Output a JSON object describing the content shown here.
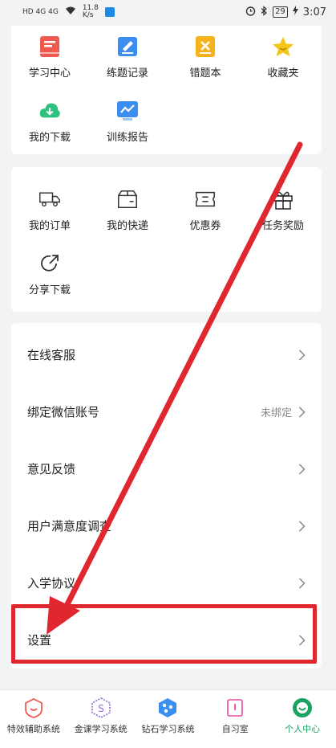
{
  "status_bar": {
    "network": "HD 4G 4G",
    "speed": "11.8\nK/s",
    "battery": "29",
    "time": "3:07"
  },
  "learn_grid": [
    {
      "label": "学习中心",
      "icon": "book-icon",
      "color": "#ef5a50"
    },
    {
      "label": "练题记录",
      "icon": "pencil-note-icon",
      "color": "#3b8ef0"
    },
    {
      "label": "错题本",
      "icon": "wrong-note-icon",
      "color": "#f5b21a"
    },
    {
      "label": "收藏夹",
      "icon": "star-icon",
      "color": "#f5c518"
    },
    {
      "label": "我的下载",
      "icon": "cloud-download-icon",
      "color": "#2ec27e"
    },
    {
      "label": "训练报告",
      "icon": "report-chart-icon",
      "color": "#3b8ef0"
    }
  ],
  "order_grid": [
    {
      "label": "我的订单",
      "icon": "truck-icon"
    },
    {
      "label": "我的快递",
      "icon": "package-icon"
    },
    {
      "label": "优惠券",
      "icon": "coupon-icon"
    },
    {
      "label": "任务奖励",
      "icon": "gift-icon"
    },
    {
      "label": "分享下载",
      "icon": "share-icon"
    }
  ],
  "menu": [
    {
      "title": "在线客服",
      "value": ""
    },
    {
      "title": "绑定微信账号",
      "value": "未绑定"
    },
    {
      "title": "意见反馈",
      "value": ""
    },
    {
      "title": "用户满意度调查",
      "value": ""
    },
    {
      "title": "入学协议",
      "value": ""
    },
    {
      "title": "设置",
      "value": ""
    }
  ],
  "tabs": [
    {
      "label": "特效辅助系统",
      "icon": "heart-shield-icon",
      "color": "#ef5a50"
    },
    {
      "label": "金课学习系统",
      "icon": "s-hexagon-icon",
      "color": "#8e6ad8"
    },
    {
      "label": "钻石学习系统",
      "icon": "molecule-icon",
      "color": "#3b8ef0"
    },
    {
      "label": "自习室",
      "icon": "study-room-icon",
      "color": "#e84aa0"
    },
    {
      "label": "个人中心",
      "icon": "profile-smile-icon",
      "color": "#1aa260",
      "active": true
    }
  ],
  "colors": {
    "annotation_red": "#e0262f",
    "background": "#f2f3f5"
  }
}
